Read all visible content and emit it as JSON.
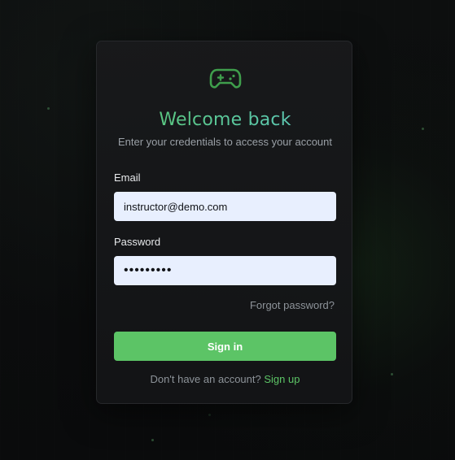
{
  "login": {
    "logo_icon": "gamepad-icon",
    "title": "Welcome back",
    "subtitle": "Enter your credentials to access your account",
    "email_label": "Email",
    "email_value": "instructor@demo.com",
    "password_label": "Password",
    "password_value": "•••••••••",
    "forgot_label": "Forgot password?",
    "signin_label": "Sign in",
    "signup_prompt": "Don't have an account?",
    "signup_label": "Sign up"
  },
  "colors": {
    "accent": "#5cc466",
    "title_gradient_start": "#59c56a",
    "title_gradient_end": "#63c9c9",
    "background": "#0b0c0d",
    "card": "#18191b",
    "input_background": "#e8effe"
  }
}
